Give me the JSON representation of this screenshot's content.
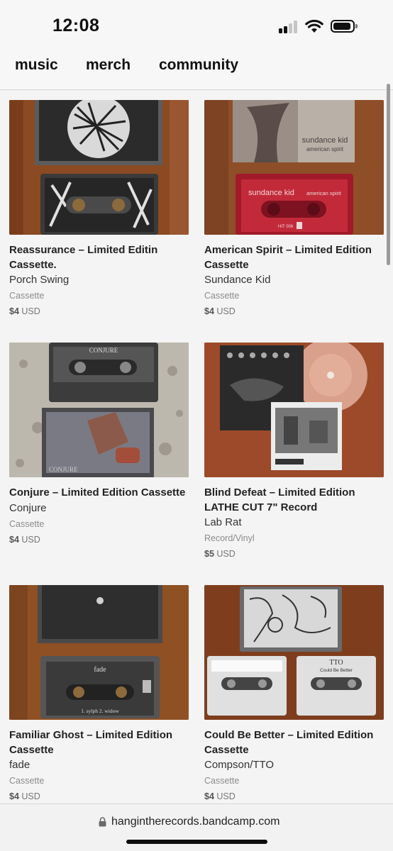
{
  "status_bar": {
    "time": "12:08",
    "icons": [
      "cellular-signal-icon",
      "wifi-icon",
      "battery-icon"
    ]
  },
  "nav": {
    "music": "music",
    "merch": "merch",
    "community": "community"
  },
  "items": [
    {
      "title": "Reassurance – Limited Editin Cassette.",
      "artist": "Porch Swing",
      "type": "Cassette",
      "price": "$4",
      "currency": "USD"
    },
    {
      "title": "American Spirit – Limited Edition Cassette",
      "artist": "Sundance Kid",
      "type": "Cassette",
      "price": "$4",
      "currency": "USD",
      "art_text": {
        "case": "sundance kid",
        "case_sub": "american spirit",
        "tape": "sundance kid",
        "tape_sub": "american spirit",
        "catalog": "HIT 006"
      }
    },
    {
      "title": "Conjure – Limited Edition Cassette",
      "artist": "Conjure",
      "type": "Cassette",
      "price": "$4",
      "currency": "USD",
      "art_text": {
        "tape": "CONJURE",
        "case": "CONJURE"
      }
    },
    {
      "title": "Blind Defeat – Limited Edition LATHE CUT 7\" Record",
      "artist": "Lab Rat",
      "type": "Record/Vinyl",
      "price": "$5",
      "currency": "USD"
    },
    {
      "title": "Familiar Ghost – Limited Edition Cassette",
      "artist": "fade",
      "type": "Cassette",
      "price": "$4",
      "currency": "USD",
      "art_text": {
        "tape": "fade",
        "tracks": "1. sylph 2. widow"
      }
    },
    {
      "title": "Could Be Better – Limited Edition Cassette",
      "artist": "Compson/TTO",
      "type": "Cassette",
      "price": "$4",
      "currency": "USD",
      "art_text": {
        "tape_right": "TTO",
        "tape_right_sub": "Could Be Better"
      }
    }
  ],
  "browser": {
    "url": "hangintherecords.bandcamp.com"
  }
}
